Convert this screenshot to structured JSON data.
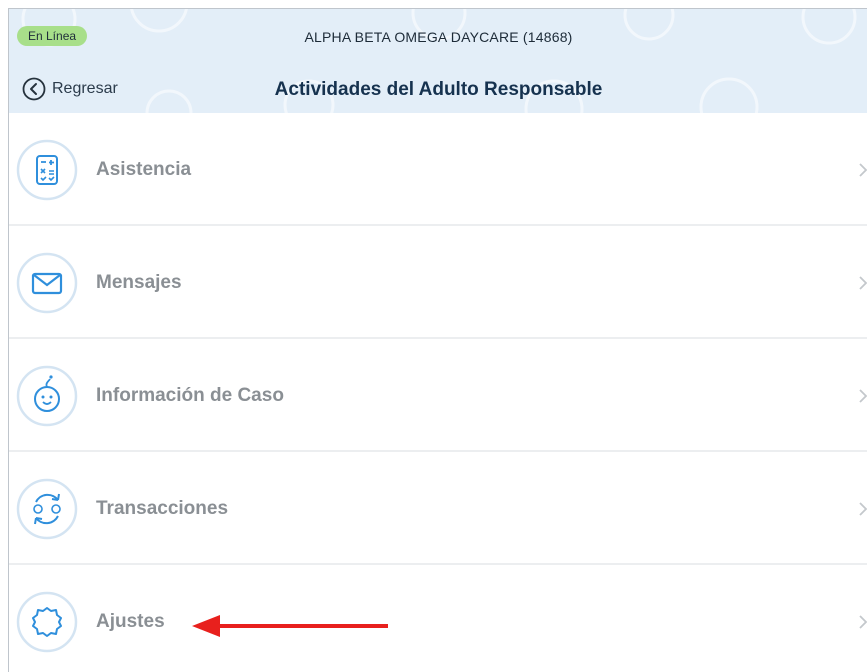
{
  "header": {
    "status_badge": "En Línea",
    "daycare_name": "ALPHA BETA OMEGA DAYCARE (14868)",
    "back_label": "Regresar",
    "page_title": "Actividades del Adulto Responsable"
  },
  "menu": {
    "items": [
      {
        "label": "Asistencia",
        "icon": "calculator-icon"
      },
      {
        "label": "Mensajes",
        "icon": "envelope-icon"
      },
      {
        "label": "Información de Caso",
        "icon": "baby-face-icon"
      },
      {
        "label": "Transacciones",
        "icon": "exchange-cycle-icon"
      },
      {
        "label": "Ajustes",
        "icon": "gear-icon"
      }
    ]
  },
  "colors": {
    "header_bg": "#e3eef8",
    "status_green": "#a8df8a",
    "icon_blue": "#2f8fdc",
    "annotation_red": "#e8201d"
  }
}
